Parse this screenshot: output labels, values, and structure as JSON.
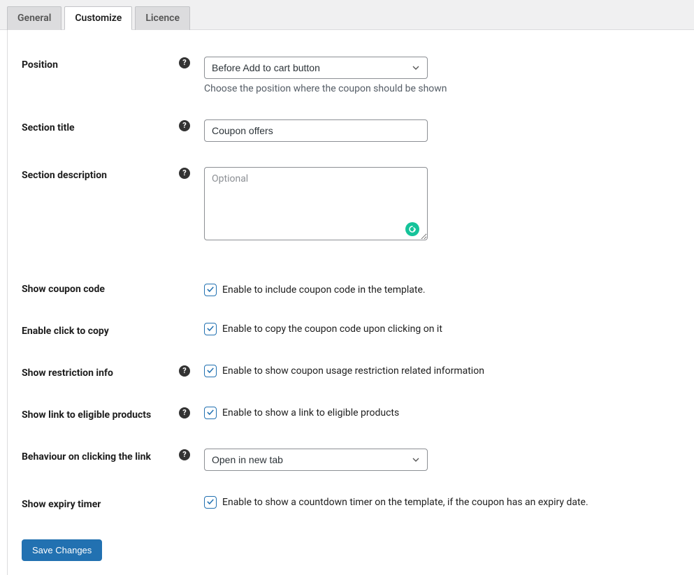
{
  "tabs": {
    "general": "General",
    "customize": "Customize",
    "licence": "Licence"
  },
  "fields": {
    "position": {
      "label": "Position",
      "value": "Before Add to cart button",
      "description": "Choose the position where the coupon should be shown"
    },
    "section_title": {
      "label": "Section title",
      "value": "Coupon offers"
    },
    "section_description": {
      "label": "Section description",
      "placeholder": "Optional",
      "value": ""
    },
    "show_coupon_code": {
      "label": "Show coupon code",
      "text": "Enable to include coupon code in the template."
    },
    "enable_click_copy": {
      "label": "Enable click to copy",
      "text": "Enable to copy the coupon code upon clicking on it"
    },
    "show_restriction": {
      "label": "Show restriction info",
      "text": "Enable to show coupon usage restriction related information"
    },
    "show_link_eligible": {
      "label": "Show link to eligible products",
      "text": "Enable to show a link to eligible products"
    },
    "behaviour_link": {
      "label": "Behaviour on clicking the link",
      "value": "Open in new tab"
    },
    "show_expiry": {
      "label": "Show expiry timer",
      "text": "Enable to show a countdown timer on the template, if the coupon has an expiry date."
    }
  },
  "buttons": {
    "save": "Save Changes"
  }
}
